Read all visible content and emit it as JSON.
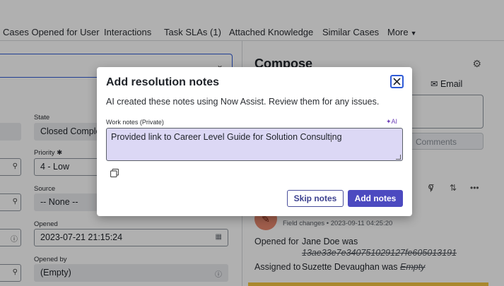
{
  "tabs": [
    {
      "label": "Cases Opened for User"
    },
    {
      "label": "Interactions"
    },
    {
      "label": "Task SLAs (1)"
    },
    {
      "label": "Attached Knowledge"
    },
    {
      "label": "Similar Cases"
    },
    {
      "label": "More"
    }
  ],
  "form": {
    "state_label": "State",
    "state_value": "Closed Complete",
    "priority_label": "Priority",
    "priority_required_mark": "✱",
    "priority_value": "4 - Low",
    "source_label": "Source",
    "source_value": "-- None --",
    "opened_label": "Opened",
    "opened_value": "2023-07-21 21:15:24",
    "opened_by_label": "Opened by",
    "opened_by_value": "(Empty)"
  },
  "compose": {
    "title": "Compose",
    "email_tab": "Email",
    "comments_button": "Comments"
  },
  "activity": {
    "field_changes": "Field changes",
    "timestamp": "2023-09-11 04:25:20",
    "rows": [
      {
        "label": "Opened for",
        "value": "Jane Doe was",
        "old_value": "13ae33e7e340751029127fe605013191"
      },
      {
        "label": "Assigned to",
        "value": "Suzette Devaughan was",
        "old_value": "Empty"
      }
    ]
  },
  "modal": {
    "title": "Add resolution notes",
    "description": "AI created these notes using Now Assist. Review them for any issues.",
    "work_notes_label": "Work notes (Private)",
    "ai_badge": "AI",
    "notes_value": "Provided link to Career Level Guide for Solution Consulting",
    "skip_button": "Skip notes",
    "add_button": "Add notes"
  },
  "colors": {
    "primary": "#4c4ac0",
    "focus_ring": "#2f5bd6",
    "notes_highlight": "#dcd8f5",
    "ai_accent": "#6e3fb8"
  },
  "icons": [
    "close-icon",
    "copy-icon",
    "settings-icon",
    "email-icon",
    "search-icon",
    "filter-icon",
    "sort-icon",
    "more-icon",
    "info-icon",
    "calendar-icon",
    "chevron-down-icon",
    "edit-icon",
    "sparkle-icon"
  ]
}
